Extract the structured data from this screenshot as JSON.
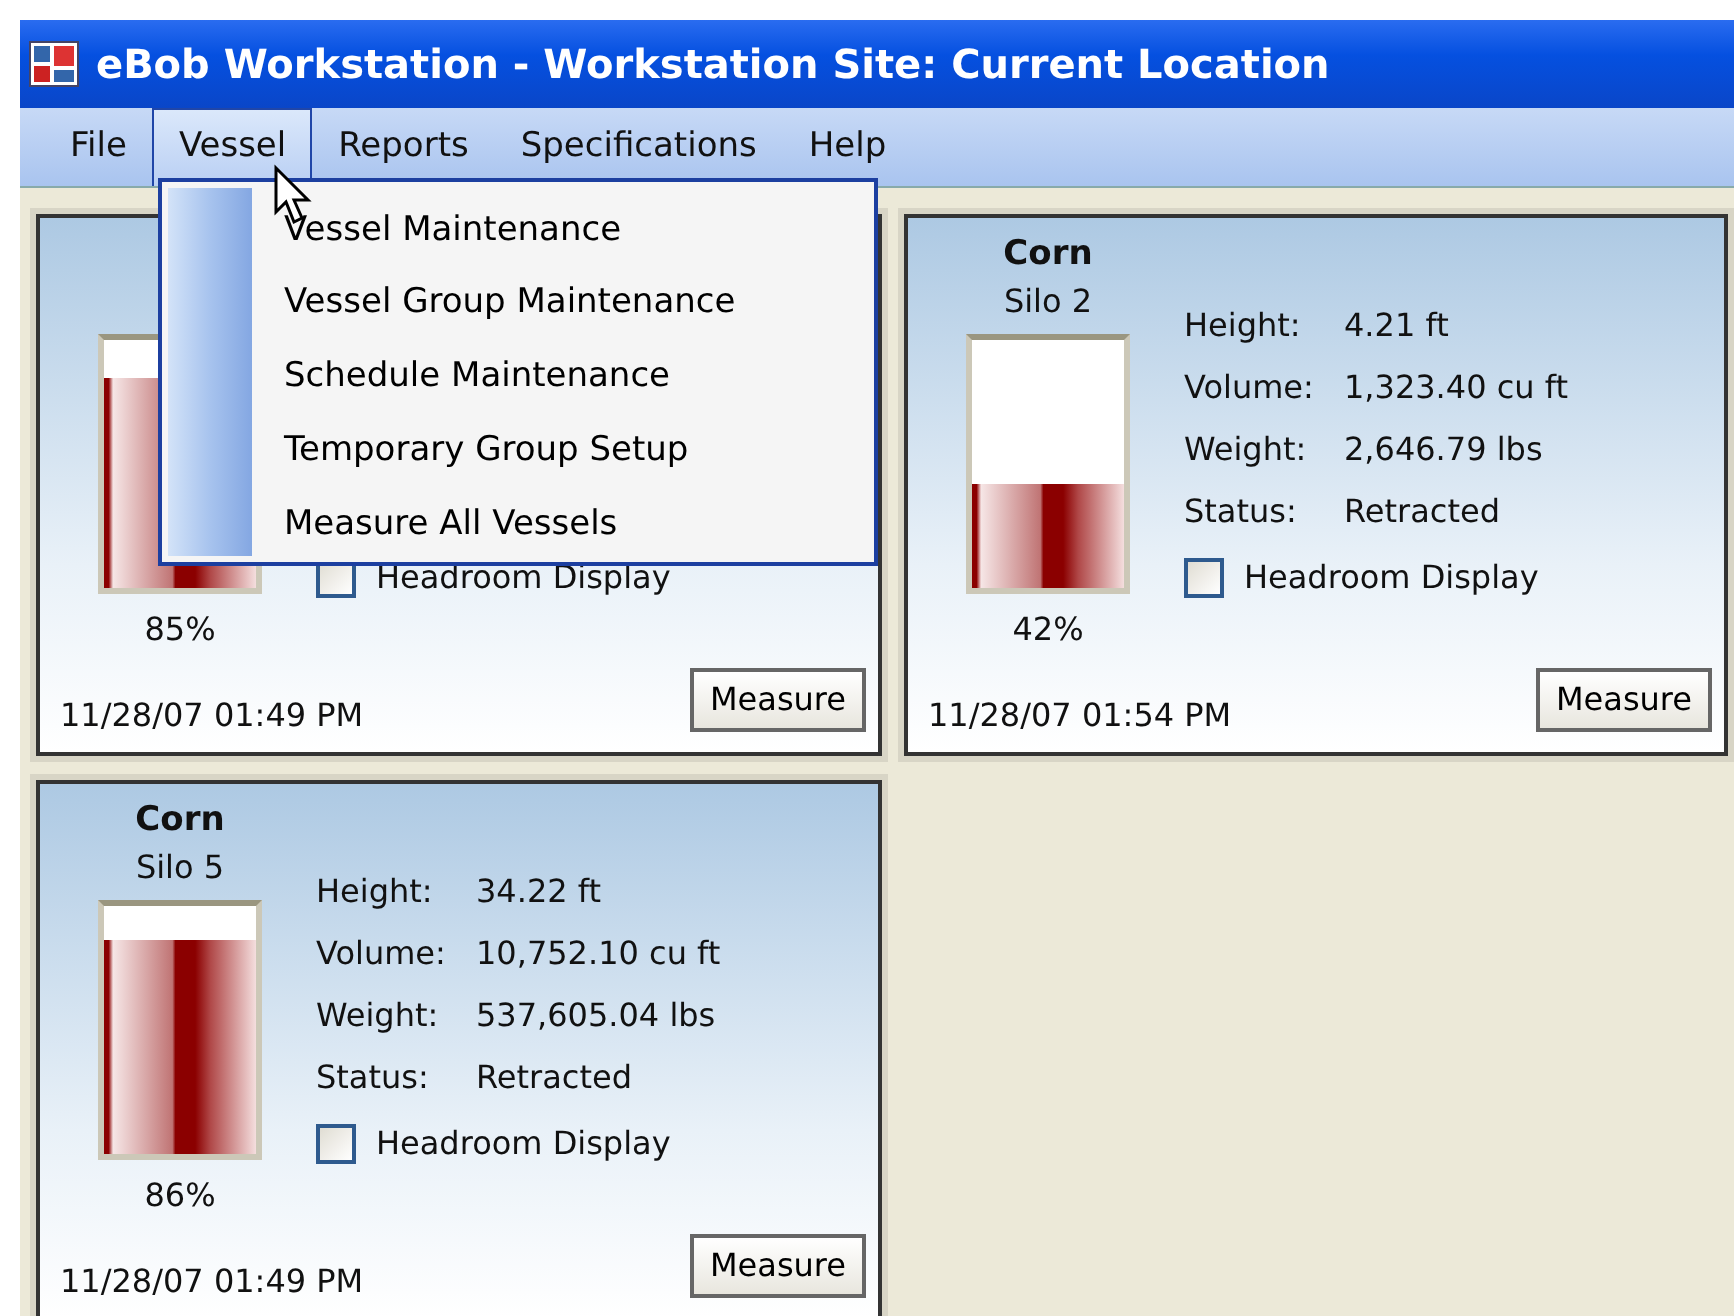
{
  "window": {
    "title": "eBob Workstation - Workstation Site: Current Location"
  },
  "menu_bar": [
    {
      "label": "File",
      "selected": false
    },
    {
      "label": "Vessel",
      "selected": true
    },
    {
      "label": "Reports",
      "selected": false
    },
    {
      "label": "Specifications",
      "selected": false
    },
    {
      "label": "Help",
      "selected": false
    }
  ],
  "dropdown": {
    "items": [
      "Vessel Maintenance",
      "Vessel Group Maintenance",
      "Schedule Maintenance",
      "Temporary Group Setup",
      "Measure All Vessels"
    ]
  },
  "panels": [
    {
      "level": 0.85,
      "percent": "85%",
      "headroom": {
        "label": "Headroom Display",
        "checked": false
      },
      "timestamp": "11/28/07 01:49 PM",
      "button": "Measure"
    },
    {
      "product": "Corn",
      "silo": "Silo 2",
      "fields": [
        {
          "label": "Height:",
          "value": "4.21 ft"
        },
        {
          "label": "Volume:",
          "value": "1,323.40 cu ft"
        },
        {
          "label": "Weight:",
          "value": "2,646.79 lbs"
        },
        {
          "label": "Status:",
          "value": "Retracted"
        }
      ],
      "level": 0.42,
      "percent": "42%",
      "headroom": {
        "label": "Headroom Display",
        "checked": false
      },
      "timestamp": "11/28/07 01:54 PM",
      "button": "Measure"
    },
    {
      "product": "Corn",
      "silo": "Silo 5",
      "fields": [
        {
          "label": "Height:",
          "value": "34.22 ft"
        },
        {
          "label": "Volume:",
          "value": "10,752.10 cu ft"
        },
        {
          "label": "Weight:",
          "value": "537,605.04 lbs"
        },
        {
          "label": "Status:",
          "value": "Retracted"
        }
      ],
      "level": 0.86,
      "percent": "86%",
      "headroom": {
        "label": "Headroom Display",
        "checked": false
      },
      "timestamp": "11/28/07 01:49 PM",
      "button": "Measure"
    }
  ]
}
